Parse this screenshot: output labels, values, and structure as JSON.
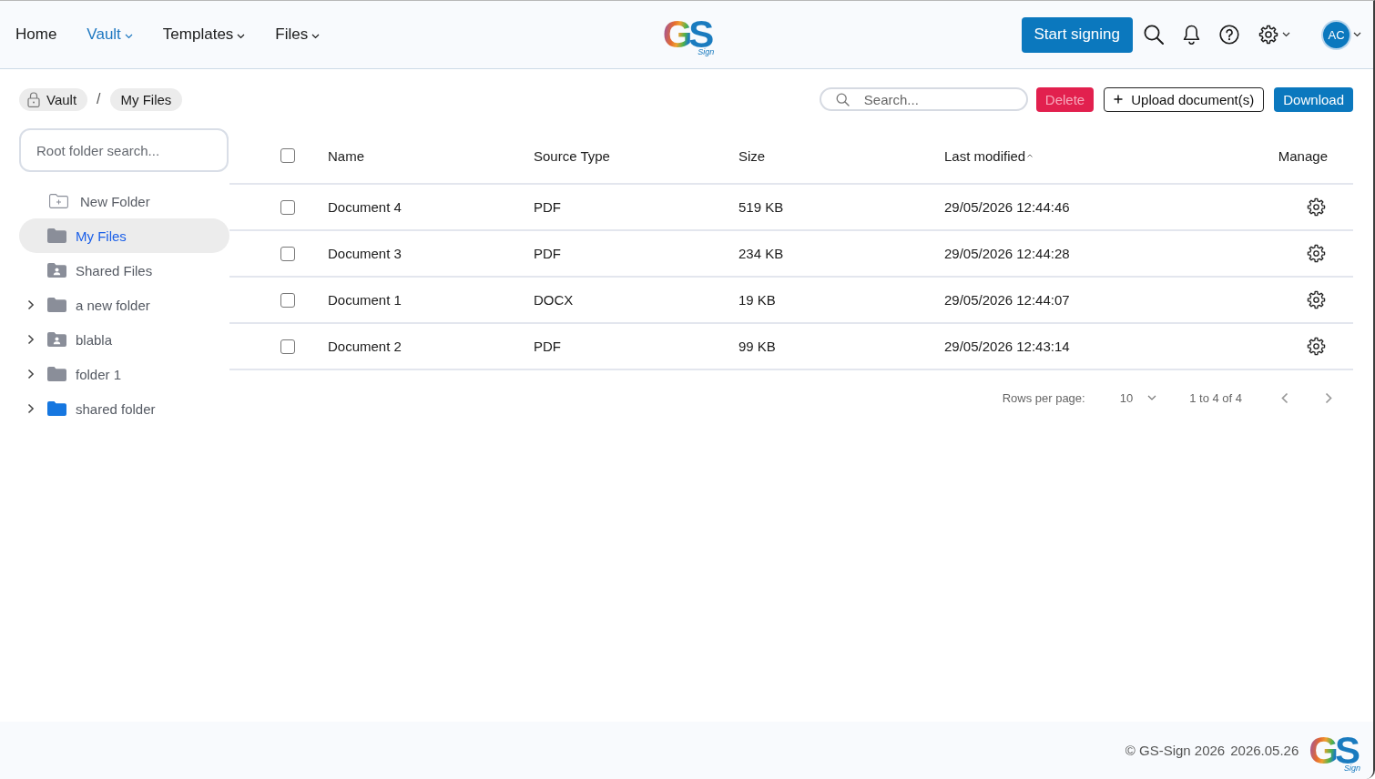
{
  "nav": {
    "items": [
      {
        "label": "Home",
        "selected": false,
        "dropdown": false
      },
      {
        "label": "Vault",
        "selected": true,
        "dropdown": true
      },
      {
        "label": "Templates",
        "selected": false,
        "dropdown": true
      },
      {
        "label": "Files",
        "selected": false,
        "dropdown": true
      }
    ],
    "logo": {
      "letters": "GS",
      "caption": "Sign"
    },
    "start_button": "Start signing",
    "user": {
      "initials": "AC"
    }
  },
  "breadcrumb": {
    "items": [
      {
        "label": "Vault",
        "locked": true
      },
      {
        "label": "My Files",
        "locked": false
      }
    ],
    "separator": "/"
  },
  "toolbar": {
    "search": {
      "placeholder": "Search..."
    },
    "buttons": [
      {
        "label": "Delete",
        "kind": "danger",
        "disabled": true
      },
      {
        "label": "Upload document(s)",
        "kind": "add",
        "disabled": false
      },
      {
        "label": "Download",
        "kind": "primary",
        "disabled": false
      }
    ]
  },
  "sidebar": {
    "search": {
      "placeholder": "Root folder search..."
    },
    "new_folder": "New Folder",
    "items": [
      {
        "label": "My Files",
        "kind": "folder",
        "color": "#8a8e99",
        "selected": true,
        "expandable": false
      },
      {
        "label": "Shared Files",
        "kind": "shared",
        "color": "#8a8e99",
        "selected": false,
        "expandable": false
      },
      {
        "label": "a new folder",
        "kind": "folder",
        "color": "#8a8e99",
        "selected": false,
        "expandable": true,
        "expanded": false
      },
      {
        "label": "blabla",
        "kind": "shared",
        "color": "#8a8e99",
        "selected": false,
        "expandable": true,
        "expanded": false
      },
      {
        "label": "folder 1",
        "kind": "folder",
        "color": "#8a8e99",
        "selected": false,
        "expandable": true,
        "expanded": false
      },
      {
        "label": "shared folder",
        "kind": "folder",
        "color": "#1677e0",
        "selected": false,
        "expandable": true,
        "expanded": false
      }
    ]
  },
  "table": {
    "all_checked": false,
    "columns": [
      {
        "label": "Name",
        "sorted": false
      },
      {
        "label": "Source Type",
        "sorted": false
      },
      {
        "label": "Size",
        "sorted": false
      },
      {
        "label": "Last modified",
        "sorted": true
      },
      {
        "label": "Manage",
        "sorted": false
      }
    ],
    "rows": [
      {
        "name": "Document 4",
        "source_type": "PDF",
        "size": "519 KB",
        "modified": "29/05/2026 12:44:46",
        "checked": false
      },
      {
        "name": "Document 3",
        "source_type": "PDF",
        "size": "234 KB",
        "modified": "29/05/2026 12:44:28",
        "checked": false
      },
      {
        "name": "Document 1",
        "source_type": "DOCX",
        "size": "19 KB",
        "modified": "29/05/2026 12:44:07",
        "checked": false
      },
      {
        "name": "Document 2",
        "source_type": "PDF",
        "size": "99 KB",
        "modified": "29/05/2026 12:43:14",
        "checked": false
      }
    ]
  },
  "pagination": {
    "rows_per_page_label": "Rows per page:",
    "rows_per_page": "10",
    "range": "1 to 4 of 4"
  },
  "footer": {
    "copyright": "© GS-Sign 2026",
    "version": "2026.05.26",
    "logo": {
      "letters": "GS",
      "caption": "Sign"
    }
  }
}
